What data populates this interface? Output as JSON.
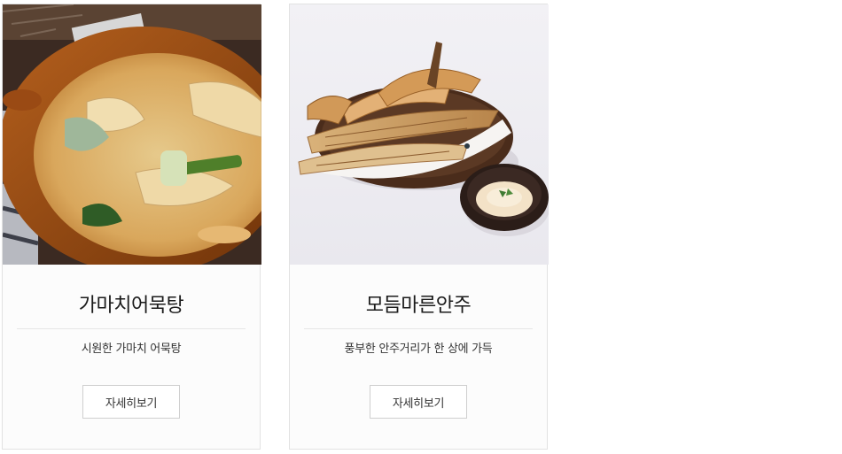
{
  "menu_items": [
    {
      "title": "가마치어묵탕",
      "description": "시원한 가마치 어묵탕",
      "button_label": "자세히보기",
      "image_subject": "fish-cake-soup-in-clay-pot"
    },
    {
      "title": "모듬마른안주",
      "description": "풍부한 안주거리가 한 상에 가득",
      "button_label": "자세히보기",
      "image_subject": "dried-fish-platter-with-mayo-dip"
    }
  ],
  "colors": {
    "card_border": "#e2e2e2",
    "card_background": "#fcfcfc",
    "button_border": "#cfcfcf",
    "text_primary": "#1b1b1b"
  }
}
